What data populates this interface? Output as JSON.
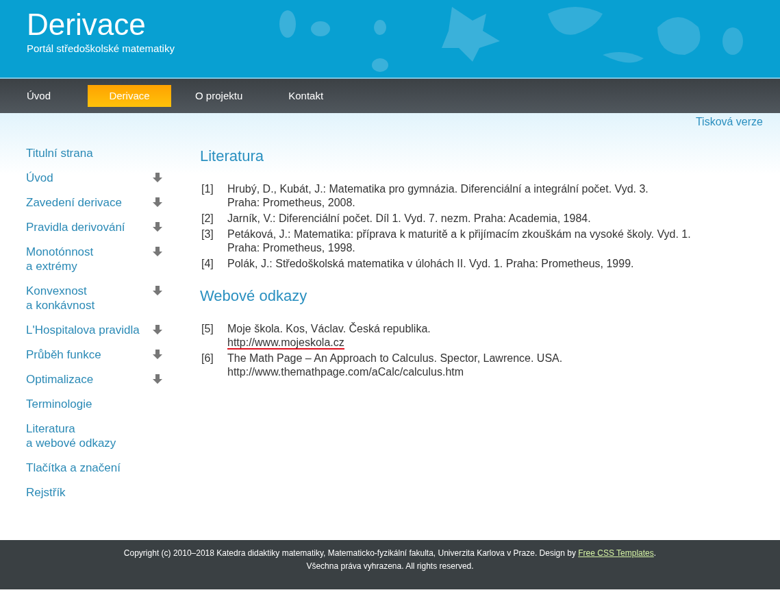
{
  "header": {
    "title": "Derivace",
    "subtitle": "Portál středoškolské matematiky"
  },
  "nav": [
    {
      "label": "Úvod",
      "selected": false
    },
    {
      "label": "Derivace",
      "selected": true
    },
    {
      "label": "O projektu",
      "selected": false
    },
    {
      "label": "Kontakt",
      "selected": false
    }
  ],
  "print_link": "Tisková verze",
  "sidebar": [
    {
      "lines": [
        "Titulní strana"
      ],
      "expandable": false
    },
    {
      "lines": [
        "Úvod"
      ],
      "expandable": true
    },
    {
      "lines": [
        "Zavedení derivace"
      ],
      "expandable": true
    },
    {
      "lines": [
        "Pravidla derivování"
      ],
      "expandable": true
    },
    {
      "lines": [
        "Monotónnost",
        "a extrémy"
      ],
      "expandable": true
    },
    {
      "lines": [
        "Konvexnost",
        "a konkávnost"
      ],
      "expandable": true
    },
    {
      "lines": [
        "L'Hospitalova pravidla"
      ],
      "expandable": true
    },
    {
      "lines": [
        "Průběh funkce"
      ],
      "expandable": true
    },
    {
      "lines": [
        "Optimalizace"
      ],
      "expandable": true
    },
    {
      "lines": [
        "Terminologie"
      ],
      "expandable": false
    },
    {
      "lines": [
        "Literatura",
        "a webové odkazy"
      ],
      "expandable": false
    },
    {
      "lines": [
        "Tlačítka a značení"
      ],
      "expandable": false
    },
    {
      "lines": [
        "Rejstřík"
      ],
      "expandable": false
    }
  ],
  "sections": [
    {
      "heading": "Literatura",
      "references": [
        {
          "number": "[1]",
          "lines": [
            "Hrubý, D., Kubát, J.: Matematika pro gymnázia. Diferenciální a integrální počet. Vyd. 3.",
            "Praha: Prometheus, 2008."
          ]
        },
        {
          "number": "[2]",
          "lines": [
            "Jarník, V.: Diferenciální počet. Díl 1. Vyd. 7. nezm. Praha: Academia, 1984."
          ]
        },
        {
          "number": "[3]",
          "lines": [
            "Petáková, J.: Matematika: příprava k maturitě a k přijímacím zkouškám na vysoké školy. Vyd. 1.",
            "Praha: Prometheus, 1998."
          ]
        },
        {
          "number": "[4]",
          "lines": [
            "Polák, J.: Středoškolská matematika v úlohách II. Vyd. 1. Praha: Prometheus, 1999."
          ]
        }
      ]
    },
    {
      "heading": "Webové odkazy",
      "references": [
        {
          "number": "[5]",
          "lines": [
            "Moje škola. Kos, Václav. Česká republika."
          ],
          "url": {
            "text": "http://www.mojeskola.cz",
            "underlined": true
          }
        },
        {
          "number": "[6]",
          "lines": [
            "The Math Page – An Approach to Calculus. Spector, Lawrence. USA."
          ],
          "url": {
            "text": "http://www.themathpage.com/aCalc/calculus.htm",
            "underlined": false
          }
        }
      ]
    }
  ],
  "footer": {
    "copyright": "Copyright (c) 2010–2018 Katedra didaktiky matematiky, Matematicko-fyzikální fakulta, Univerzita Karlova v Praze. Design by",
    "link": "Free CSS Templates",
    "after_link": ".",
    "rights": "Všechna práva vyhrazena. All rights reserved."
  }
}
